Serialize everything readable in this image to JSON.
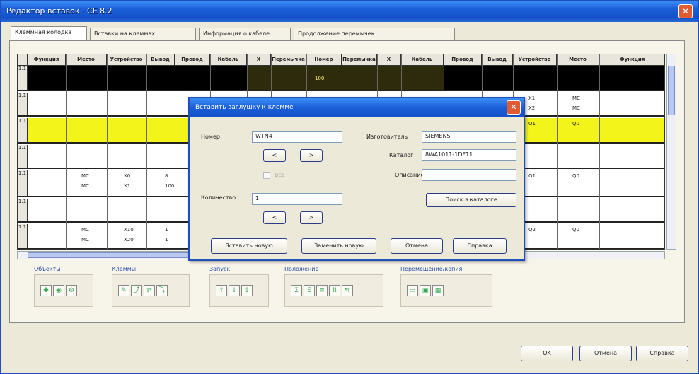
{
  "window": {
    "title": "Редактор вставок · CE 8.2",
    "close_label": "✕"
  },
  "tabs": [
    "Клеммная колодка",
    "Вставки на клеммах",
    "Информация о кабеле",
    "Продолжение перемычек"
  ],
  "grid": {
    "headers": [
      "Функция",
      "Место",
      "Устройство",
      "Вывод",
      "Провод",
      "Кабель",
      "Х",
      "Перемычка",
      "Номер",
      "Перемычка",
      "Х",
      "Кабель",
      "Провод",
      "Вывод",
      "Устройство",
      "Место",
      "Функция"
    ],
    "row_header": "1.1",
    "highlight_value": "100",
    "right_cells": [
      {
        "row": 1,
        "a": "X1",
        "b": "MC"
      },
      {
        "row": 1,
        "a": "X2",
        "b": "MC"
      },
      {
        "row": 2,
        "a": "Q1",
        "b": "Q0"
      },
      {
        "row": 4,
        "a": "Q1",
        "b": "Q0"
      },
      {
        "row": 6,
        "a": "Q2",
        "b": "Q0"
      }
    ],
    "left_cells": [
      {
        "row": 4,
        "m": "MC",
        "d": "X0",
        "p": "8"
      },
      {
        "row": 4,
        "m": "MC",
        "d": "X1",
        "p": "100"
      },
      {
        "row": 6,
        "m": "MC",
        "d": "X10",
        "p": "1"
      },
      {
        "row": 6,
        "m": "MC",
        "d": "X20",
        "p": "1"
      }
    ]
  },
  "toolbar_groups": [
    {
      "label": "Объекты",
      "tools": [
        "✚",
        "◉",
        "⚙"
      ]
    },
    {
      "label": "Клеммы",
      "tools": [
        "✎",
        "⤴",
        "⇄",
        "⤵"
      ]
    },
    {
      "label": "Запуск",
      "tools": [
        "↑",
        "↓",
        "↕"
      ]
    },
    {
      "label": "Положение",
      "tools": [
        "Σ",
        "Ξ",
        "≡",
        "⇅",
        "⇆"
      ]
    },
    {
      "label": "Перемещение/копия",
      "tools": [
        "▭",
        "▣",
        "▦"
      ]
    }
  ],
  "dialog": {
    "title": "Вставить заглушку к клемме",
    "close_label": "✕",
    "number_label": "Номер",
    "number_value": "WTN4",
    "prev_label": "<",
    "next_label": ">",
    "check_label": "Все",
    "manufacturer_label": "Изготовитель",
    "manufacturer_value": "SIEMENS",
    "catalog_label": "Каталог",
    "catalog_value": "8WA1011-1DF11",
    "description_label": "Описание",
    "description_value": "",
    "quantity_label": "Количество",
    "quantity_value": "1",
    "qty_prev_label": "<",
    "qty_next_label": ">",
    "lookup_label": "Поиск в каталоге",
    "insert_label": "Вставить новую",
    "replace_label": "Заменить новую",
    "cancel_label": "Отмена",
    "help_label": "Справка"
  },
  "footer": {
    "ok_label": "OK",
    "cancel_label": "Отмена",
    "help_label": "Справка"
  },
  "colors": {
    "highlight": "#f3f51a",
    "dark_row": "#000000",
    "title": "#1a5fd8"
  }
}
